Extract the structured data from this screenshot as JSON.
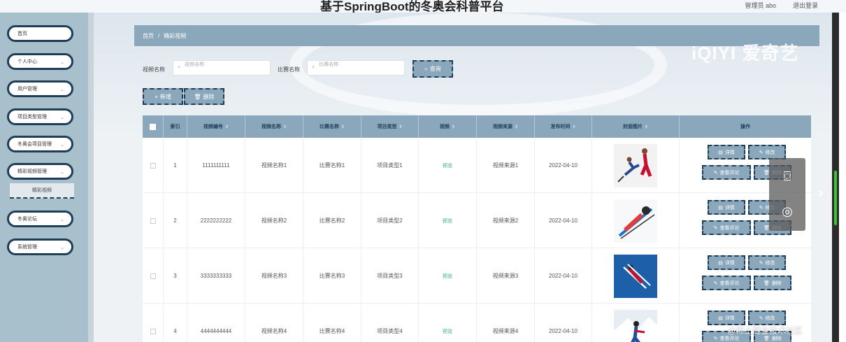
{
  "header": {
    "title": "基于SpringBoot的冬奥会科普平台",
    "user_info": "管理员 abo",
    "logout_label": "退出登录"
  },
  "sidebar": {
    "items": [
      {
        "label": "首页",
        "has_chevron": false
      },
      {
        "label": "个人中心",
        "has_chevron": true
      },
      {
        "label": "用户管理",
        "has_chevron": true
      },
      {
        "label": "项目类型管理",
        "has_chevron": true
      },
      {
        "label": "冬奥会项目管理",
        "has_chevron": true
      },
      {
        "label": "精彩视频管理",
        "has_chevron": true
      },
      {
        "label": "冬奥论坛",
        "has_chevron": true
      },
      {
        "label": "系统管理",
        "has_chevron": true
      }
    ],
    "submenu_label": "精彩视频"
  },
  "breadcrumb": {
    "home": "首页",
    "separator": "/",
    "current": "精彩视频"
  },
  "watermark_logo": "iQIYI 爱奇艺",
  "search": {
    "video_name_label": "视频名称",
    "video_name_placeholder": "视频名称",
    "match_name_label": "比赛名称",
    "match_name_placeholder": "比赛名称",
    "query_button": "查询"
  },
  "actions": {
    "add_label": "新增",
    "delete_label": "删除"
  },
  "table": {
    "columns": [
      "索引",
      "视频编号",
      "视频名称",
      "比赛名称",
      "项目类型",
      "视频",
      "视频来源",
      "发布时间",
      "封面图片",
      "操作"
    ],
    "rows": [
      {
        "index": "1",
        "video_no": "1111111111",
        "video_name": "视频名称1",
        "match_name": "比赛名称1",
        "project_type": "项目类型1",
        "video": "预览",
        "source": "视频来源1",
        "date": "2022-04-10",
        "cover": "figure-skating-pair"
      },
      {
        "index": "2",
        "video_no": "2222222222",
        "video_name": "视频名称2",
        "match_name": "比赛名称2",
        "project_type": "项目类型2",
        "video": "预览",
        "source": "视频来源2",
        "date": "2022-04-10",
        "cover": "ski-jumper"
      },
      {
        "index": "3",
        "video_no": "3333333333",
        "video_name": "视频名称3",
        "match_name": "比赛名称3",
        "project_type": "项目类型3",
        "video": "预览",
        "source": "视频来源3",
        "date": "2022-04-10",
        "cover": "ski-jumper-blue-sky"
      },
      {
        "index": "4",
        "video_no": "4444444444",
        "video_name": "视频名称4",
        "match_name": "比赛名称4",
        "project_type": "项目类型4",
        "video": "预览",
        "source": "视频来源4",
        "date": "2022-04-10",
        "cover": "alpine-skier"
      }
    ],
    "op_labels": {
      "detail": "详情",
      "edit": "修改",
      "comments": "查看评论",
      "delete": "删除"
    }
  },
  "footer_watermark": "@稀土掘金技术社区",
  "colors": {
    "accent": "#8aa7bb",
    "dark_border": "#1f3d57",
    "sidebar_bg": "#a8bfcc",
    "preview_green": "#3aa88f"
  }
}
